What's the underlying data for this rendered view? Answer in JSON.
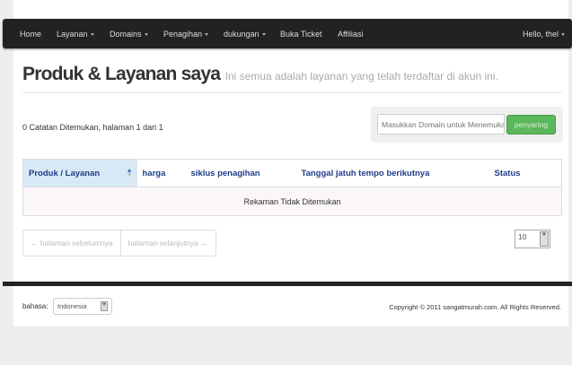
{
  "nav": {
    "items": [
      {
        "label": "Home",
        "dropdown": false
      },
      {
        "label": "Layanan",
        "dropdown": true
      },
      {
        "label": "Domains",
        "dropdown": true
      },
      {
        "label": "Penagihan",
        "dropdown": true
      },
      {
        "label": "dukungan",
        "dropdown": true
      },
      {
        "label": "Buka Ticket",
        "dropdown": false
      },
      {
        "label": "Affiliasi",
        "dropdown": false
      }
    ],
    "user": "Hello, thel"
  },
  "header": {
    "title": "Produk & Layanan saya",
    "subtitle": "Ini semua adalah layanan yang telah terdaftar di akun ini."
  },
  "count_text": "0 Catatan Ditemukan, halaman 1 dari 1",
  "filter": {
    "placeholder": "Masukkan Domain untuk Menemukan",
    "button": "penyaring"
  },
  "table": {
    "columns": [
      "Produk / Layanan",
      "harga",
      "siklus penagihan",
      "Tanggal jatuh tempo berikutnya",
      "Status"
    ],
    "empty": "Rekaman Tidak Ditemukan"
  },
  "pager": {
    "prev": "← halaman sebelumnya",
    "next": "halaman selanjutnya →",
    "per_page": "10"
  },
  "footer": {
    "lang_label": "bahasa:",
    "lang_value": "Indonesia",
    "copyright": "Copyright © 2011 sangatmurah.com. All Rights Reserved."
  }
}
